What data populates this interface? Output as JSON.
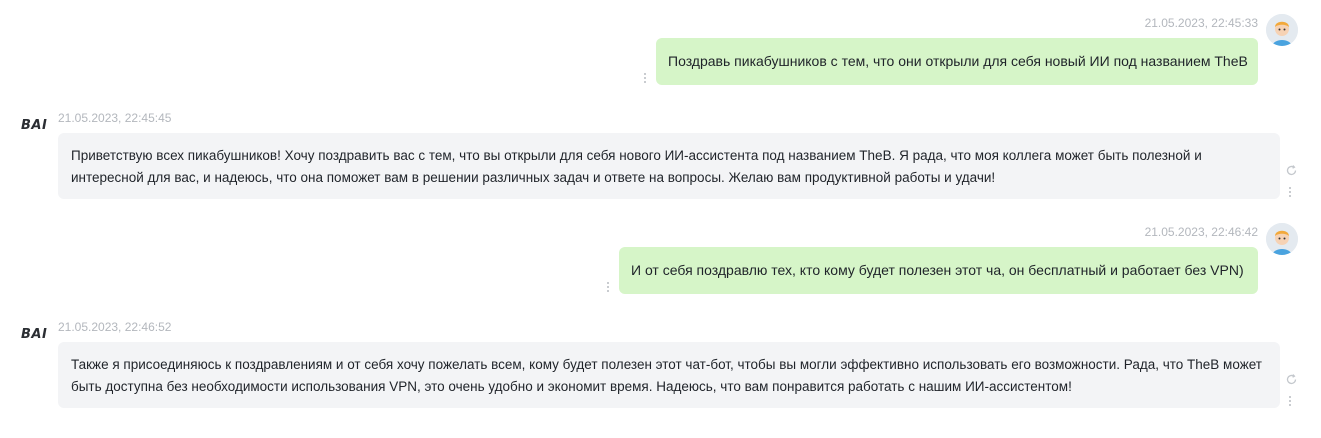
{
  "messages": [
    {
      "role": "user",
      "timestamp": "21.05.2023, 22:45:33",
      "text": "Поздравь пикабушников с тем, что они открыли для себя новый ИИ под названием TheB"
    },
    {
      "role": "assistant",
      "sender": "BAI",
      "timestamp": "21.05.2023, 22:45:45",
      "text": "Приветствую всех пикабушников! Хочу поздравить вас с тем, что вы открыли для себя нового ИИ-ассистента под названием TheB. Я рада, что моя коллега может быть полезной и интересной для вас, и надеюсь, что она поможет вам в решении различных задач и ответе на вопросы. Желаю вам продуктивной работы и удачи!"
    },
    {
      "role": "user",
      "timestamp": "21.05.2023, 22:46:42",
      "text": "И от себя поздравлю тех, кто кому будет полезен этот ча, он бесплатный и работает без VPN)"
    },
    {
      "role": "assistant",
      "sender": "BAI",
      "timestamp": "21.05.2023, 22:46:52",
      "text": "Также я присоединяюсь к поздравлениям и от себя хочу пожелать всем, кому будет полезен этот чат-бот, чтобы вы могли эффективно использовать его возможности. Рада, что TheB может быть доступна без необходимости использования VPN, это очень удобно и экономит время. Надеюсь, что вам понравится работать с нашим ИИ-ассистентом!"
    }
  ],
  "colors": {
    "user_bubble": "#d6f5c8",
    "bot_bubble": "#f3f4f6",
    "timestamp": "#b3b7bd",
    "text": "#1f2329"
  },
  "icons": {
    "user_avatar": "user-avatar-icon",
    "bot_logo": "bai-logo",
    "more": "vertical-dots-icon",
    "regenerate": "refresh-icon"
  }
}
